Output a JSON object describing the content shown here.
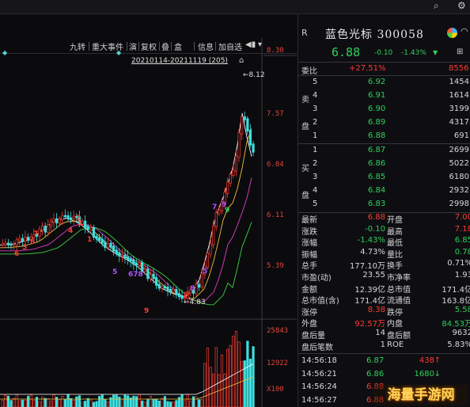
{
  "toolbar": {
    "buttons": [
      "九转",
      "重大事件",
      "演",
      "复权",
      "叠",
      "盒",
      "信息",
      "加自选"
    ]
  },
  "chart": {
    "range_label": "20210114-20211119 (205)",
    "high_label": "8.12",
    "low_label": "4.83",
    "y_ticks": [
      "8.30",
      "7.57",
      "6.84",
      "6.11",
      "5.39"
    ],
    "vol_ticks": [
      "25843",
      "12922",
      "X100"
    ],
    "td_marks": [
      {
        "t": "9",
        "c": "#ff3b30"
      },
      {
        "t": "8",
        "c": "#ff3b30"
      },
      {
        "t": "7",
        "c": "#ff3b30"
      },
      {
        "t": "6",
        "c": "#ff3b30"
      },
      {
        "t": "5",
        "c": "#ff3b30"
      },
      {
        "t": "4",
        "c": "#ff3b30"
      },
      {
        "t": "3",
        "c": "#ff3b30"
      },
      {
        "t": "2",
        "c": "#ff3b30"
      },
      {
        "t": "1",
        "c": "#ff3b30"
      },
      {
        "t": "5",
        "c": "#b050ff"
      },
      {
        "t": "678",
        "c": "#b050ff"
      },
      {
        "t": "9",
        "c": "#ff3b30"
      },
      {
        "t": "9",
        "c": "#b050ff"
      },
      {
        "t": "7",
        "c": "#b050ff"
      },
      {
        "t": "9",
        "c": "#2fd05a"
      },
      {
        "t": "8",
        "c": "#b050ff"
      },
      {
        "t": "5",
        "c": "#b050ff"
      }
    ]
  },
  "stock": {
    "name": "蓝色光标",
    "code": "300058",
    "price": "6.88",
    "change": "-0.10",
    "change_pct": "-1.43%",
    "weibi_label": "委比",
    "weibi_val": "+27.51%",
    "weibi_vol": "8556",
    "sell_side": "卖盘",
    "buy_side": "买盘",
    "sells": [
      {
        "lvl": "5",
        "price": "6.92",
        "vol": "1454"
      },
      {
        "lvl": "4",
        "price": "6.91",
        "vol": "1614"
      },
      {
        "lvl": "3",
        "price": "6.90",
        "vol": "3199"
      },
      {
        "lvl": "2",
        "price": "6.89",
        "vol": "4317"
      },
      {
        "lvl": "1",
        "price": "6.88",
        "vol": "691"
      }
    ],
    "buys": [
      {
        "lvl": "1",
        "price": "6.87",
        "vol": "2699"
      },
      {
        "lvl": "2",
        "price": "6.86",
        "vol": "5022"
      },
      {
        "lvl": "3",
        "price": "6.85",
        "vol": "6180"
      },
      {
        "lvl": "4",
        "price": "6.84",
        "vol": "2932"
      },
      {
        "lvl": "5",
        "price": "6.83",
        "vol": "2998"
      }
    ],
    "stats": [
      {
        "l": "最新",
        "v": "6.88",
        "vc": "red",
        "l2": "开盘",
        "v2": "7.00",
        "v2c": "red"
      },
      {
        "l": "涨跌",
        "v": "-0.10",
        "vc": "grn",
        "l2": "最高",
        "v2": "7.18",
        "v2c": "red"
      },
      {
        "l": "涨幅",
        "v": "-1.43%",
        "vc": "grn",
        "l2": "最低",
        "v2": "6.85",
        "v2c": "grn"
      },
      {
        "l": "振幅",
        "v": "4.73%",
        "vc": "wht",
        "l2": "量比",
        "v2": "0.78",
        "v2c": "grn"
      },
      {
        "l": "总手",
        "v": "177.10万",
        "vc": "wht",
        "l2": "换手",
        "v2": "0.71%",
        "v2c": "wht"
      },
      {
        "l": "市盈(动)",
        "v": "23.55",
        "vc": "wht",
        "l2": "市净率",
        "v2": "1.93",
        "v2c": "wht"
      },
      {
        "l": "金额",
        "v": "12.39亿",
        "vc": "wht",
        "l2": "总市值",
        "v2": "171.4亿",
        "v2c": "wht"
      },
      {
        "l": "总市值(含)",
        "v": "171.4亿",
        "vc": "wht",
        "l2": "流通值",
        "v2": "163.8亿",
        "v2c": "wht"
      },
      {
        "l": "涨停",
        "v": "8.38",
        "vc": "red",
        "l2": "跌停",
        "v2": "5.58",
        "v2c": "grn"
      },
      {
        "l": "外盘",
        "v": "92.57万",
        "vc": "red",
        "l2": "内盘",
        "v2": "84.53万",
        "v2c": "grn"
      },
      {
        "l": "盘后量",
        "v": "14",
        "vc": "wht",
        "l2": "盘后额",
        "v2": "9632",
        "v2c": "wht"
      },
      {
        "l": "盘后笔数",
        "v": "1",
        "vc": "wht",
        "l2": "ROE",
        "v2": "5.83%",
        "v2c": "wht"
      }
    ],
    "ticks": [
      {
        "t": "14:56:18",
        "p": "6.87",
        "pc": "grn",
        "v": "438",
        "vc": "red",
        "arrow": "↑",
        "ac": "red"
      },
      {
        "t": "14:56:21",
        "p": "6.86",
        "pc": "grn",
        "v": "1680",
        "vc": "grn",
        "arrow": "↓",
        "ac": "grn"
      },
      {
        "t": "14:56:24",
        "p": "6.88",
        "pc": "red",
        "v": "",
        "vc": "wht",
        "arrow": "",
        "ac": "wht"
      },
      {
        "t": "14:56:27",
        "p": "6.88",
        "pc": "red",
        "v": "",
        "vc": "wht",
        "arrow": "",
        "ac": "wht"
      }
    ]
  },
  "watermark": "海量手游网"
}
